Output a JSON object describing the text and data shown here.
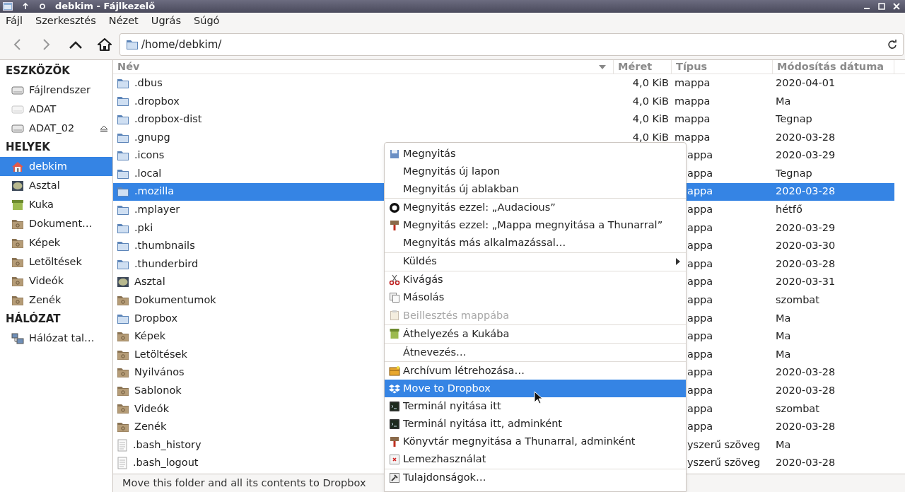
{
  "window": {
    "title": "debkim - Fájlkezelő"
  },
  "menubar": [
    "Fájl",
    "Szerkesztés",
    "Nézet",
    "Ugrás",
    "Súgó"
  ],
  "location": {
    "value": "/home/debkim/"
  },
  "sidebar": {
    "sections": [
      {
        "heading": "ESZKÖZÖK",
        "items": [
          {
            "label": "Fájlrendszer",
            "selected": false,
            "mounted": true,
            "ejectable": false
          },
          {
            "label": "ADAT",
            "selected": false,
            "mounted": false,
            "ejectable": false
          },
          {
            "label": "ADAT_02",
            "selected": false,
            "mounted": true,
            "ejectable": true
          }
        ]
      },
      {
        "heading": "HELYEK",
        "items": [
          {
            "label": "debkim",
            "selected": true
          },
          {
            "label": "Asztal",
            "selected": false
          },
          {
            "label": "Kuka",
            "selected": false
          },
          {
            "label": "Dokument…",
            "selected": false
          },
          {
            "label": "Képek",
            "selected": false
          },
          {
            "label": "Letöltések",
            "selected": false
          },
          {
            "label": "Videók",
            "selected": false
          },
          {
            "label": "Zenék",
            "selected": false
          }
        ]
      },
      {
        "heading": "HÁLÓZAT",
        "items": [
          {
            "label": "Hálózat tal…",
            "selected": false
          }
        ]
      }
    ]
  },
  "table": {
    "columns": [
      {
        "label": "Név",
        "sorted": true
      },
      {
        "label": "Méret",
        "sorted": false
      },
      {
        "label": "Típus",
        "sorted": false
      },
      {
        "label": "Módosítás dátuma",
        "sorted": false
      }
    ],
    "rows": [
      {
        "name": ".dbus",
        "size": "4,0 KiB",
        "type": "mappa",
        "date": "2020-04-01",
        "kind": "folder",
        "selected": false
      },
      {
        "name": ".dropbox",
        "size": "4,0 KiB",
        "type": "mappa",
        "date": "Ma",
        "kind": "folder",
        "selected": false
      },
      {
        "name": ".dropbox-dist",
        "size": "4,0 KiB",
        "type": "mappa",
        "date": "Tegnap",
        "kind": "folder",
        "selected": false
      },
      {
        "name": ".gnupg",
        "size": "4,0 KiB",
        "type": "mappa",
        "date": "2020-03-28",
        "kind": "folder",
        "selected": false
      },
      {
        "name": ".icons",
        "type": "appa",
        "date": "2020-03-29",
        "kind": "folder",
        "selected": false
      },
      {
        "name": ".local",
        "type": "appa",
        "date": "Tegnap",
        "kind": "folder",
        "selected": false
      },
      {
        "name": ".mozilla",
        "type": "appa",
        "date": "2020-03-28",
        "kind": "folder",
        "selected": true
      },
      {
        "name": ".mplayer",
        "type": "appa",
        "date": "hétfő",
        "kind": "folder",
        "selected": false
      },
      {
        "name": ".pki",
        "type": "appa",
        "date": "2020-03-29",
        "kind": "folder",
        "selected": false
      },
      {
        "name": ".thumbnails",
        "type": "appa",
        "date": "2020-03-30",
        "kind": "folder",
        "selected": false
      },
      {
        "name": ".thunderbird",
        "type": "appa",
        "date": "2020-03-28",
        "kind": "folder",
        "selected": false
      },
      {
        "name": "Asztal",
        "type": "appa",
        "date": "2020-03-31",
        "kind": "desktop",
        "selected": false
      },
      {
        "name": "Dokumentumok",
        "type": "appa",
        "date": "szombat",
        "kind": "special",
        "selected": false
      },
      {
        "name": "Dropbox",
        "type": "appa",
        "date": "Ma",
        "kind": "folder",
        "selected": false
      },
      {
        "name": "Képek",
        "type": "appa",
        "date": "Ma",
        "kind": "special",
        "selected": false
      },
      {
        "name": "Letöltések",
        "type": "appa",
        "date": "Ma",
        "kind": "special",
        "selected": false
      },
      {
        "name": "Nyilvános",
        "type": "appa",
        "date": "2020-03-28",
        "kind": "special",
        "selected": false
      },
      {
        "name": "Sablonok",
        "type": "appa",
        "date": "2020-03-28",
        "kind": "special",
        "selected": false
      },
      {
        "name": "Videók",
        "type": "appa",
        "date": "szombat",
        "kind": "special",
        "selected": false
      },
      {
        "name": "Zenék",
        "type": "appa",
        "date": "2020-03-28",
        "kind": "special",
        "selected": false
      },
      {
        "name": ".bash_history",
        "type": "yszerű szöveg",
        "date": "Ma",
        "kind": "file",
        "selected": false
      },
      {
        "name": ".bash_logout",
        "type": "yszerű szöveg",
        "date": "2020-03-28",
        "kind": "file",
        "selected": false
      }
    ]
  },
  "context_menu": {
    "sections": [
      [
        {
          "label": "Megnyitás",
          "selected": false,
          "disabled": false,
          "submenu": false
        },
        {
          "label": "Megnyitás új lapon",
          "selected": false,
          "disabled": false,
          "submenu": false
        },
        {
          "label": "Megnyitás új ablakban",
          "selected": false,
          "disabled": false,
          "submenu": false
        }
      ],
      [
        {
          "label": "Megnyitás ezzel: „Audacious”",
          "selected": false,
          "disabled": false,
          "submenu": false
        },
        {
          "label": "Megnyitás ezzel: „Mappa megnyitása a Thunarral”",
          "selected": false,
          "disabled": false,
          "submenu": false
        },
        {
          "label": "Megnyitás más alkalmazással…",
          "selected": false,
          "disabled": false,
          "submenu": false
        }
      ],
      [
        {
          "label": "Küldés",
          "selected": false,
          "disabled": false,
          "submenu": true
        }
      ],
      [
        {
          "label": "Kivágás",
          "selected": false,
          "disabled": false,
          "submenu": false
        },
        {
          "label": "Másolás",
          "selected": false,
          "disabled": false,
          "submenu": false
        },
        {
          "label": "Beillesztés mappába",
          "selected": false,
          "disabled": true,
          "submenu": false
        }
      ],
      [
        {
          "label": "Áthelyezés a Kukába",
          "selected": false,
          "disabled": false,
          "submenu": false
        }
      ],
      [
        {
          "label": "Átnevezés…",
          "selected": false,
          "disabled": false,
          "submenu": false
        }
      ],
      [
        {
          "label": "Archívum létrehozása…",
          "selected": false,
          "disabled": false,
          "submenu": false
        },
        {
          "label": "Move to Dropbox",
          "selected": true,
          "disabled": false,
          "submenu": false
        },
        {
          "label": "Terminál nyitása itt",
          "selected": false,
          "disabled": false,
          "submenu": false
        },
        {
          "label": "Terminál nyitása itt, adminként",
          "selected": false,
          "disabled": false,
          "submenu": false
        },
        {
          "label": "Könyvtár megnyitása a Thunarral, adminként",
          "selected": false,
          "disabled": false,
          "submenu": false
        },
        {
          "label": "Lemezhasználat",
          "selected": false,
          "disabled": false,
          "submenu": false
        }
      ],
      [
        {
          "label": "Tulajdonságok…",
          "selected": false,
          "disabled": false,
          "submenu": false
        }
      ]
    ]
  },
  "status_bar": {
    "text": "Move this folder and all its contents to Dropbox"
  }
}
